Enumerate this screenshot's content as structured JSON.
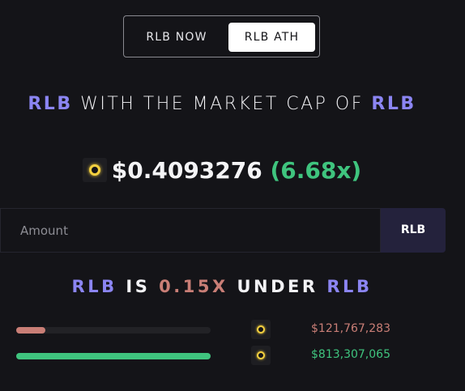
{
  "toggle": {
    "options": [
      "RLB NOW",
      "RLB ATH"
    ],
    "selected": "RLB ATH"
  },
  "headline": {
    "token_a": "RLB",
    "middle": " WITH THE MARKET CAP OF ",
    "token_b": "RLB"
  },
  "price": {
    "coin_icon": "rollbit-coin-icon",
    "value": "$0.4093276",
    "multiplier": "(6.68x)"
  },
  "amount": {
    "placeholder": "Amount",
    "unit_label": "RLB"
  },
  "comparison": {
    "token_a": "RLB",
    "is_text": "IS",
    "ratio": "0.15X",
    "direction": "UNDER",
    "token_b": "RLB"
  },
  "market_caps": [
    {
      "name": "RLB",
      "value": "$121,767,283",
      "fill_fraction": 0.15,
      "color": "#c97e76"
    },
    {
      "name": "RLB",
      "value": "$813,307,065",
      "fill_fraction": 1.0,
      "color": "#3fc47e"
    }
  ],
  "colors": {
    "accent": "#8b85f2",
    "positive": "#3fc47e",
    "negative": "#c97e76",
    "background": "#141418"
  }
}
